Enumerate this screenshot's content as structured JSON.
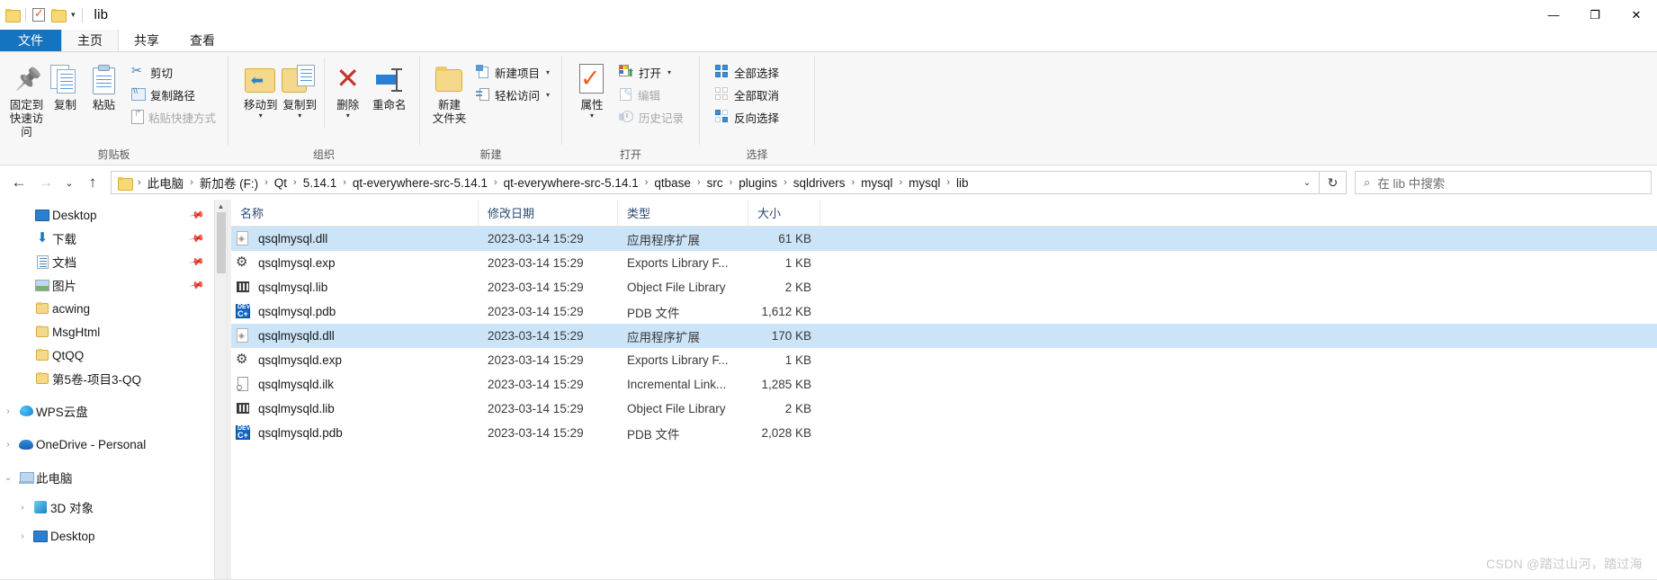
{
  "window": {
    "title": "lib",
    "quick_access": [
      "folder-icon",
      "properties-icon",
      "new-folder-icon"
    ],
    "qat_caret": "▾",
    "controls": {
      "minimize": "—",
      "maximize": "❐",
      "close": "✕"
    }
  },
  "tabs": [
    {
      "label": "文件",
      "kind": "file"
    },
    {
      "label": "主页",
      "kind": "active"
    },
    {
      "label": "共享",
      "kind": "normal"
    },
    {
      "label": "查看",
      "kind": "normal"
    }
  ],
  "ribbon": {
    "groups": [
      {
        "label": "剪贴板",
        "big": [
          {
            "label": "固定到\n快速访问",
            "line1": "固定到",
            "line2": "快速访问",
            "icon": "pin-icon"
          },
          {
            "label": "复制",
            "line1": "复制",
            "line2": "",
            "icon": "copy-icon"
          },
          {
            "label": "粘贴",
            "line1": "粘贴",
            "line2": "",
            "icon": "paste-icon"
          }
        ],
        "small": [
          {
            "label": "剪切",
            "icon": "scissors-icon",
            "disabled": false
          },
          {
            "label": "复制路径",
            "icon": "copy-path-icon",
            "disabled": false
          },
          {
            "label": "粘贴快捷方式",
            "icon": "paste-shortcut-icon",
            "disabled": true
          }
        ]
      },
      {
        "label": "组织",
        "big": [
          {
            "line1": "移动到",
            "line2": "",
            "icon": "move-to-icon",
            "dropdown": "▾"
          },
          {
            "line1": "复制到",
            "line2": "",
            "icon": "copy-to-icon",
            "dropdown": "▾"
          },
          {
            "line1": "删除",
            "line2": "",
            "icon": "delete-icon",
            "dropdown": "▾"
          },
          {
            "line1": "重命名",
            "line2": "",
            "icon": "rename-icon"
          }
        ],
        "small": []
      },
      {
        "label": "新建",
        "big": [
          {
            "line1": "新建",
            "line2": "文件夹",
            "icon": "new-folder-icon"
          }
        ],
        "small": [
          {
            "label": "新建项目",
            "icon": "new-item-icon",
            "caret": "▾",
            "disabled": false
          },
          {
            "label": "轻松访问",
            "icon": "easy-access-icon",
            "caret": "▾",
            "disabled": false
          }
        ]
      },
      {
        "label": "打开",
        "big": [
          {
            "line1": "属性",
            "line2": "",
            "icon": "properties-icon",
            "dropdown": "▾"
          }
        ],
        "small": [
          {
            "label": "打开",
            "icon": "open-icon",
            "caret": "▾",
            "disabled": false
          },
          {
            "label": "编辑",
            "icon": "edit-icon",
            "disabled": true
          },
          {
            "label": "历史记录",
            "icon": "history-icon",
            "disabled": true
          }
        ]
      },
      {
        "label": "选择",
        "big": [],
        "small": [
          {
            "label": "全部选择",
            "icon": "select-all-icon",
            "disabled": false
          },
          {
            "label": "全部取消",
            "icon": "select-none-icon",
            "disabled": false
          },
          {
            "label": "反向选择",
            "icon": "invert-selection-icon",
            "disabled": false
          }
        ]
      }
    ]
  },
  "address": {
    "back": "←",
    "forward": "→",
    "recent": "⌄",
    "up": "↑",
    "crumbs": [
      "此电脑",
      "新加卷 (F:)",
      "Qt",
      "5.14.1",
      "qt-everywhere-src-5.14.1",
      "qt-everywhere-src-5.14.1",
      "qtbase",
      "src",
      "plugins",
      "sqldrivers",
      "mysql",
      "mysql",
      "lib"
    ],
    "separator": "›",
    "dropdown_caret": "⌄",
    "refresh": "↻"
  },
  "search": {
    "icon": "search-icon",
    "placeholder": "在 lib 中搜索"
  },
  "navpane": {
    "items": [
      {
        "label": "Desktop",
        "icon": "desktop-icon",
        "indent": 1,
        "chevron": "",
        "pin": true
      },
      {
        "label": "下载",
        "icon": "downloads-icon",
        "indent": 1,
        "chevron": "",
        "pin": true
      },
      {
        "label": "文档",
        "icon": "documents-icon",
        "indent": 1,
        "chevron": "",
        "pin": true
      },
      {
        "label": "图片",
        "icon": "pictures-icon",
        "indent": 1,
        "chevron": "",
        "pin": true
      },
      {
        "label": "acwing",
        "icon": "folder-icon",
        "indent": 1,
        "chevron": "",
        "pin": false
      },
      {
        "label": "MsgHtml",
        "icon": "folder-icon",
        "indent": 1,
        "chevron": "",
        "pin": false
      },
      {
        "label": "QtQQ",
        "icon": "folder-icon",
        "indent": 1,
        "chevron": "",
        "pin": false
      },
      {
        "label": "第5卷-项目3-QQ",
        "icon": "folder-icon",
        "indent": 1,
        "chevron": "",
        "pin": false
      },
      {
        "label": "WPS云盘",
        "icon": "wps-cloud-icon",
        "indent": 0,
        "chevron": "›",
        "pin": false,
        "gap": true
      },
      {
        "label": "OneDrive - Personal",
        "icon": "onedrive-icon",
        "indent": 0,
        "chevron": "›",
        "pin": false,
        "gap": true
      },
      {
        "label": "此电脑",
        "icon": "this-pc-icon",
        "indent": 0,
        "chevron": "⌄",
        "pin": false,
        "gap": true
      },
      {
        "label": "3D 对象",
        "icon": "3d-objects-icon",
        "indent": 1,
        "chevron": "›",
        "pin": false,
        "gap": true
      },
      {
        "label": "Desktop",
        "icon": "desktop-icon",
        "indent": 1,
        "chevron": "›",
        "pin": false,
        "gap": false
      }
    ]
  },
  "filelist": {
    "columns": [
      {
        "key": "name",
        "label": "名称",
        "sorted": true,
        "sort_caret": "⌃"
      },
      {
        "key": "date",
        "label": "修改日期",
        "sorted": false
      },
      {
        "key": "type",
        "label": "类型",
        "sorted": false
      },
      {
        "key": "size",
        "label": "大小",
        "sorted": false
      }
    ],
    "rows": [
      {
        "name": "qsqlmysql.dll",
        "date": "2023-03-14 15:29",
        "type": "应用程序扩展",
        "size": "61 KB",
        "icon": "dll-file-icon",
        "selected": true
      },
      {
        "name": "qsqlmysql.exp",
        "date": "2023-03-14 15:29",
        "type": "Exports Library F...",
        "size": "1 KB",
        "icon": "exp-file-icon",
        "selected": false
      },
      {
        "name": "qsqlmysql.lib",
        "date": "2023-03-14 15:29",
        "type": "Object File Library",
        "size": "2 KB",
        "icon": "lib-file-icon",
        "selected": false
      },
      {
        "name": "qsqlmysql.pdb",
        "date": "2023-03-14 15:29",
        "type": "PDB 文件",
        "size": "1,612 KB",
        "icon": "pdb-file-icon",
        "selected": false
      },
      {
        "name": "qsqlmysqld.dll",
        "date": "2023-03-14 15:29",
        "type": "应用程序扩展",
        "size": "170 KB",
        "icon": "dll-file-icon",
        "selected": true
      },
      {
        "name": "qsqlmysqld.exp",
        "date": "2023-03-14 15:29",
        "type": "Exports Library F...",
        "size": "1 KB",
        "icon": "exp-file-icon",
        "selected": false
      },
      {
        "name": "qsqlmysqld.ilk",
        "date": "2023-03-14 15:29",
        "type": "Incremental Link...",
        "size": "1,285 KB",
        "icon": "ilk-file-icon",
        "selected": false
      },
      {
        "name": "qsqlmysqld.lib",
        "date": "2023-03-14 15:29",
        "type": "Object File Library",
        "size": "2 KB",
        "icon": "lib-file-icon",
        "selected": false
      },
      {
        "name": "qsqlmysqld.pdb",
        "date": "2023-03-14 15:29",
        "type": "PDB 文件",
        "size": "2,028 KB",
        "icon": "pdb-file-icon",
        "selected": false
      }
    ]
  },
  "watermark": "CSDN @踏过山河，踏过海",
  "colors": {
    "accent": "#1673c0",
    "selection": "#cce4f7",
    "column_header_text": "#2b4a6f",
    "folder": "#f5d98b"
  }
}
